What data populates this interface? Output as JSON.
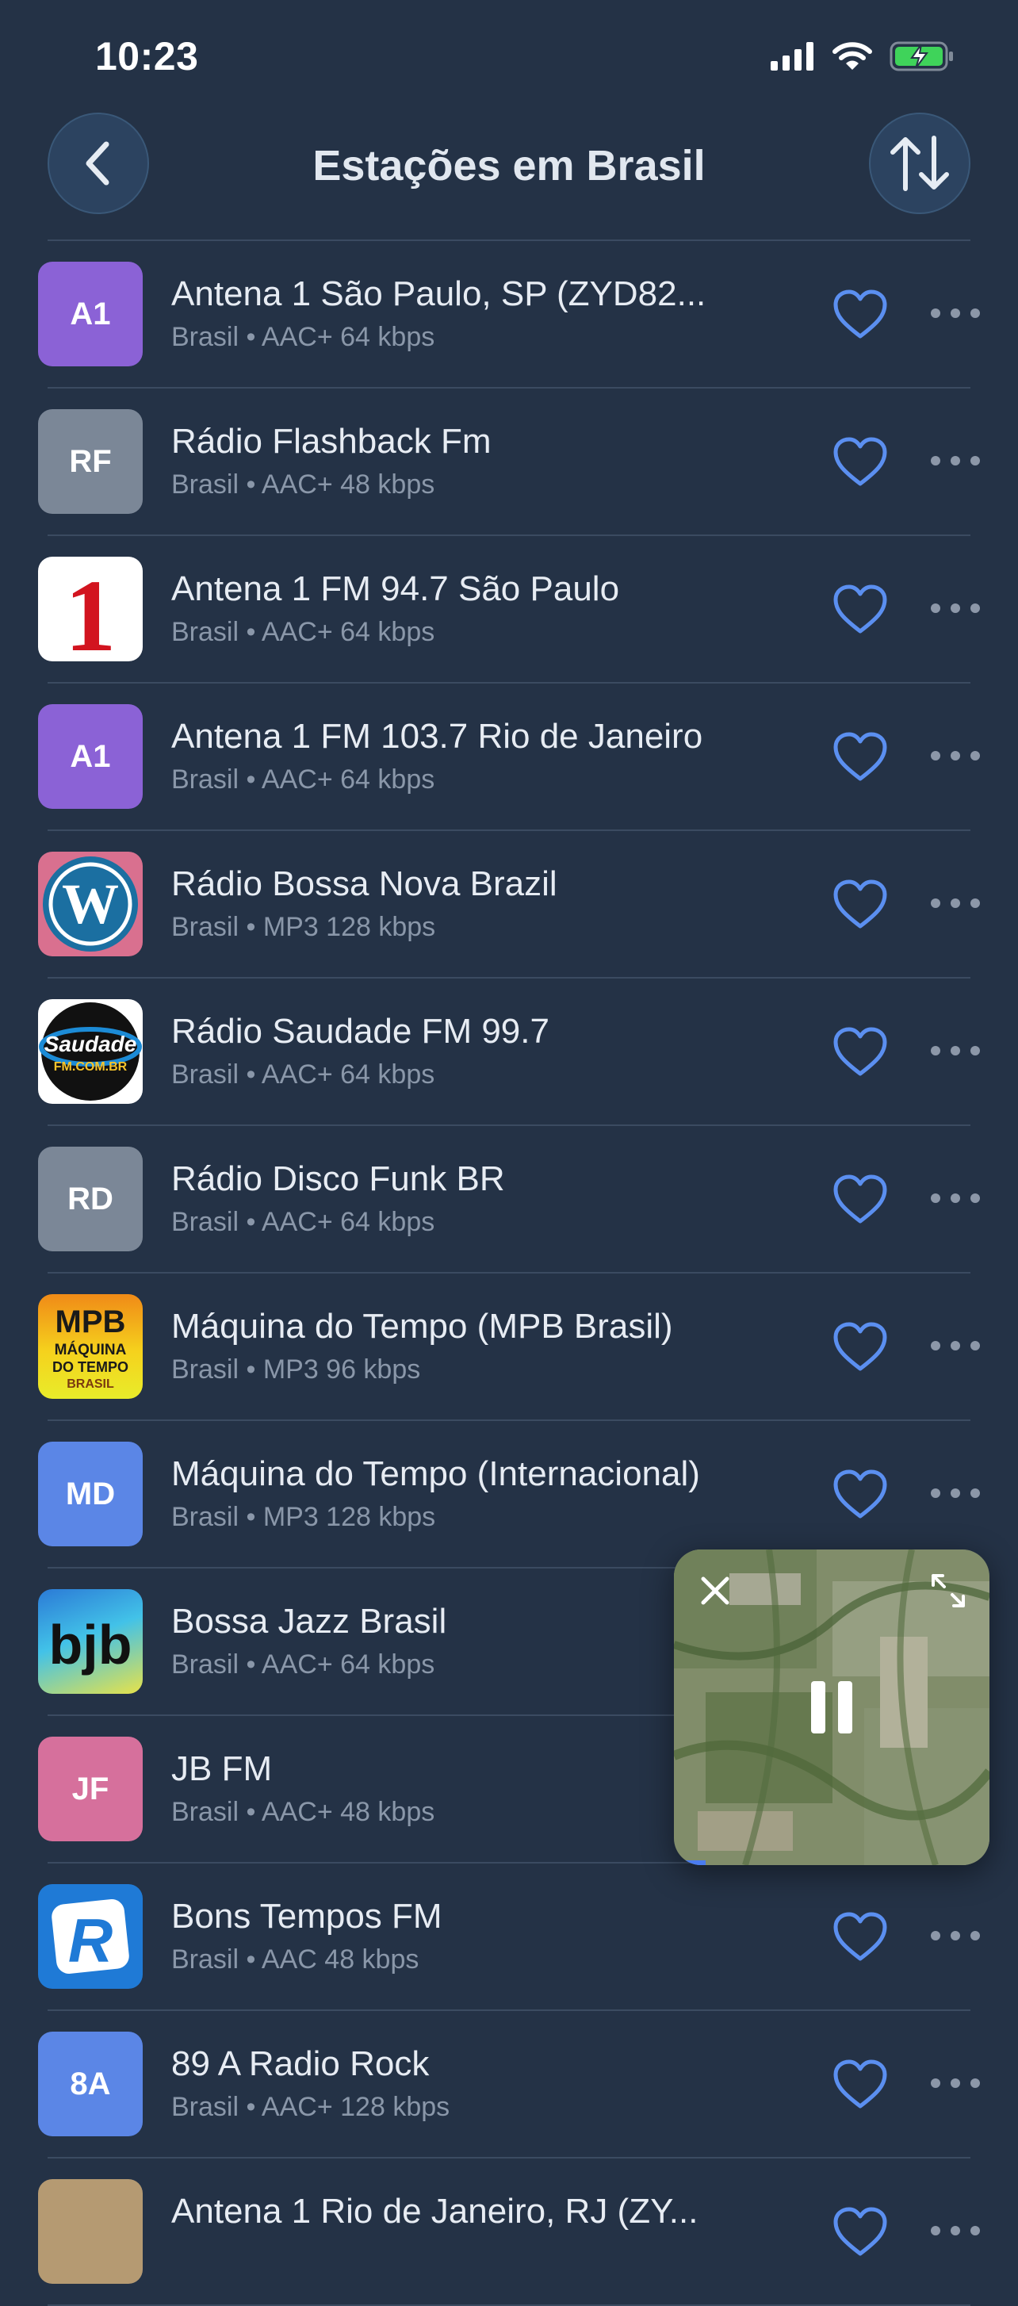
{
  "status_bar": {
    "time": "10:23"
  },
  "header": {
    "title": "Estações em Brasil"
  },
  "colors": {
    "background": "#243246",
    "accent": "#4a7cf0",
    "heart": "#5b8ff0"
  },
  "stations": [
    {
      "name": "Antena 1 São Paulo, SP (ZYD82...",
      "country": "Brasil",
      "format": "AAC+ 64 kbps",
      "logo_text": "A1",
      "logo_color": "#8b62d6",
      "logo_icon": "initials"
    },
    {
      "name": "Rádio Flashback Fm",
      "country": "Brasil",
      "format": "AAC+ 48 kbps",
      "logo_text": "RF",
      "logo_color": "#7b8797",
      "logo_icon": "initials"
    },
    {
      "name": "Antena 1 FM 94.7 São Paulo",
      "country": "Brasil",
      "format": "AAC+ 64 kbps",
      "logo_text": "1",
      "logo_color": "#ffffff",
      "logo_icon": "antena1-logo"
    },
    {
      "name": "Antena 1 FM 103.7 Rio de Janeiro",
      "country": "Brasil",
      "format": "AAC+ 64 kbps",
      "logo_text": "A1",
      "logo_color": "#8b62d6",
      "logo_icon": "initials"
    },
    {
      "name": "Rádio Bossa Nova Brazil",
      "country": "Brasil",
      "format": "MP3 128 kbps",
      "logo_text": "W",
      "logo_color": "#d9708f",
      "logo_icon": "wordpress-logo"
    },
    {
      "name": "Rádio Saudade FM 99.7",
      "country": "Brasil",
      "format": "AAC+ 64 kbps",
      "logo_text": "Saudade",
      "logo_sub": "FM.COM.BR",
      "logo_color": "#ffffff",
      "logo_icon": "saudade-logo"
    },
    {
      "name": "Rádio Disco Funk BR",
      "country": "Brasil",
      "format": "AAC+ 64 kbps",
      "logo_text": "RD",
      "logo_color": "#7b8797",
      "logo_icon": "initials"
    },
    {
      "name": "Máquina do Tempo (MPB Brasil)",
      "country": "Brasil",
      "format": "MP3 96 kbps",
      "logo_text": "MPB",
      "logo_sub1": "MÁQUINA",
      "logo_sub2": "DO TEMPO",
      "logo_sub3": "BRASIL",
      "logo_color": "#f2a71b",
      "logo_icon": "mpb-logo"
    },
    {
      "name": "Máquina do Tempo (Internacional)",
      "country": "Brasil",
      "format": "MP3 128 kbps",
      "logo_text": "MD",
      "logo_color": "#5b86e6",
      "logo_icon": "initials"
    },
    {
      "name": "Bossa Jazz Brasil",
      "country": "Brasil",
      "format": "AAC+ 64 kbps",
      "logo_text": "bjb",
      "logo_color": "#3aa0e8",
      "logo_icon": "bjb-logo"
    },
    {
      "name": "JB FM",
      "country": "Brasil",
      "format": "AAC+ 48 kbps",
      "logo_text": "JF",
      "logo_color": "#d6709c",
      "logo_icon": "initials"
    },
    {
      "name": "Bons Tempos FM",
      "country": "Brasil",
      "format": "AAC 48 kbps",
      "logo_text": "R",
      "logo_color": "#1f7ad6",
      "logo_icon": "r-logo"
    },
    {
      "name": "89 A Radio Rock",
      "country": "Brasil",
      "format": "AAC+ 128 kbps",
      "logo_text": "8A",
      "logo_color": "#5b86e6",
      "logo_icon": "initials"
    },
    {
      "name": "Antena 1 Rio de Janeiro, RJ (ZY...",
      "country": "",
      "format": "",
      "logo_text": "",
      "logo_color": "#b59a72",
      "logo_icon": "partial"
    }
  ],
  "mini_player": {
    "state": "playing",
    "progress": 0.1
  }
}
